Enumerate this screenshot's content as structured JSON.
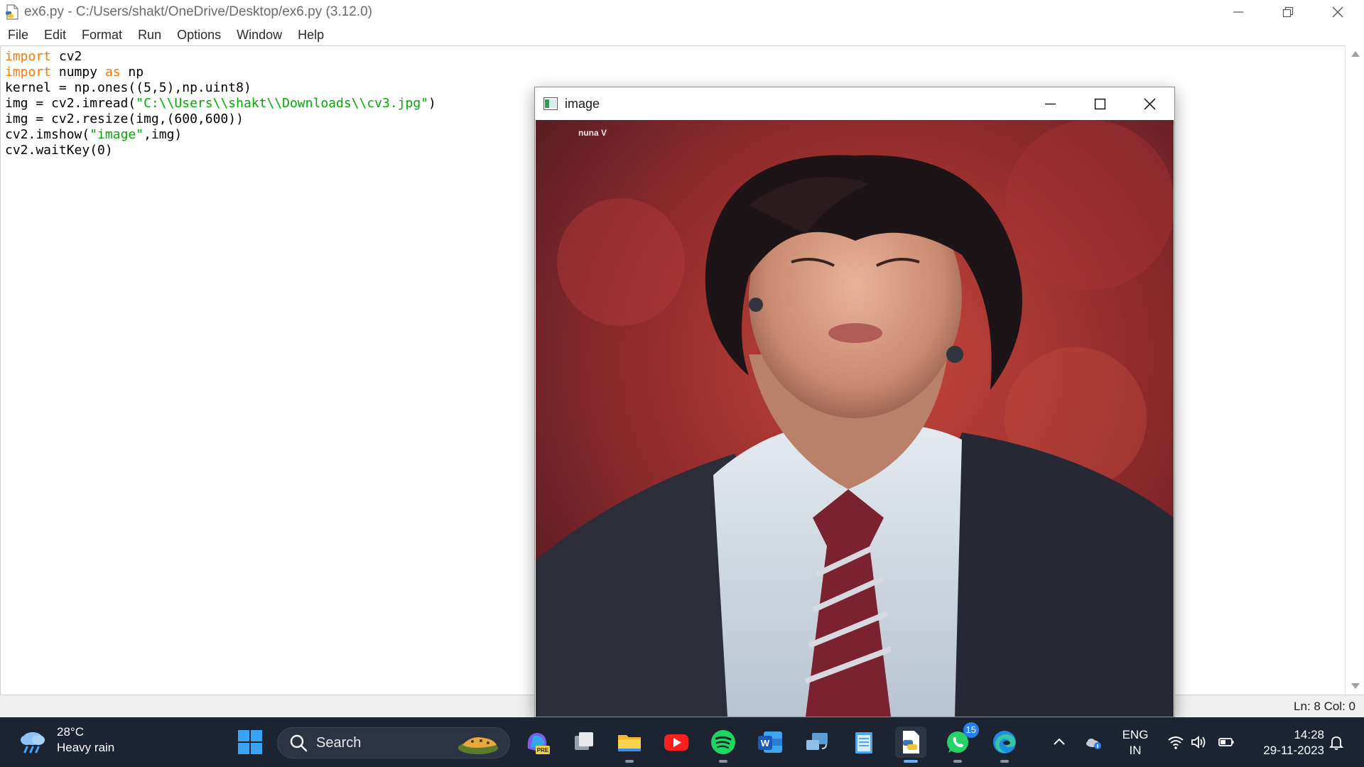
{
  "idle": {
    "title": "ex6.py - C:/Users/shakt/OneDrive/Desktop/ex6.py (3.12.0)",
    "menu": [
      "File",
      "Edit",
      "Format",
      "Run",
      "Options",
      "Window",
      "Help"
    ],
    "code_lines": [
      {
        "tokens": [
          {
            "t": "import",
            "c": "kw"
          },
          {
            "t": " cv2",
            "c": ""
          }
        ]
      },
      {
        "tokens": [
          {
            "t": "import",
            "c": "kw"
          },
          {
            "t": " numpy ",
            "c": ""
          },
          {
            "t": "as",
            "c": "kw"
          },
          {
            "t": " np",
            "c": ""
          }
        ]
      },
      {
        "tokens": [
          {
            "t": "kernel = np.ones((5,5),np.uint8)",
            "c": ""
          }
        ]
      },
      {
        "tokens": [
          {
            "t": "img = cv2.imread(",
            "c": ""
          },
          {
            "t": "\"C:\\\\Users\\\\shakt\\\\Downloads\\\\cv3.jpg\"",
            "c": "str"
          },
          {
            "t": ")",
            "c": ""
          }
        ]
      },
      {
        "tokens": [
          {
            "t": "img = cv2.resize(img,(600,600))",
            "c": ""
          }
        ]
      },
      {
        "tokens": [
          {
            "t": "cv2.imshow(",
            "c": ""
          },
          {
            "t": "\"image\"",
            "c": "str"
          },
          {
            "t": ",img)",
            "c": ""
          }
        ]
      },
      {
        "tokens": [
          {
            "t": "cv2.waitKey(0)",
            "c": ""
          }
        ]
      }
    ],
    "status": "Ln: 8   Col: 0"
  },
  "image_window": {
    "title": "image",
    "watermark": "nuna V"
  },
  "taskbar": {
    "weather": {
      "temp": "28°C",
      "desc": "Heavy rain",
      "icon": "rain-cloud-icon"
    },
    "search_label": "Search",
    "pinned": [
      {
        "name": "copilot",
        "icon": "copilot-pre-icon"
      },
      {
        "name": "task-view",
        "icon": "task-view-icon"
      },
      {
        "name": "file-explorer",
        "icon": "folder-icon"
      },
      {
        "name": "youtube",
        "icon": "youtube-icon"
      },
      {
        "name": "spotify",
        "icon": "spotify-icon"
      },
      {
        "name": "word",
        "icon": "word-icon"
      },
      {
        "name": "remote",
        "icon": "connect-icon"
      },
      {
        "name": "notepad",
        "icon": "notepad-icon"
      },
      {
        "name": "idle",
        "icon": "python-idle-icon"
      },
      {
        "name": "whatsapp",
        "icon": "whatsapp-icon"
      },
      {
        "name": "edge",
        "icon": "edge-icon"
      }
    ],
    "whatsapp_badge": "15",
    "lang_line1": "ENG",
    "lang_line2": "IN",
    "time": "14:28",
    "date": "29-11-2023"
  },
  "colors": {
    "keyword": "#ff7700",
    "string": "#00aa00",
    "taskbar_bg": "#1d2431",
    "accent": "#5fb2ff"
  }
}
